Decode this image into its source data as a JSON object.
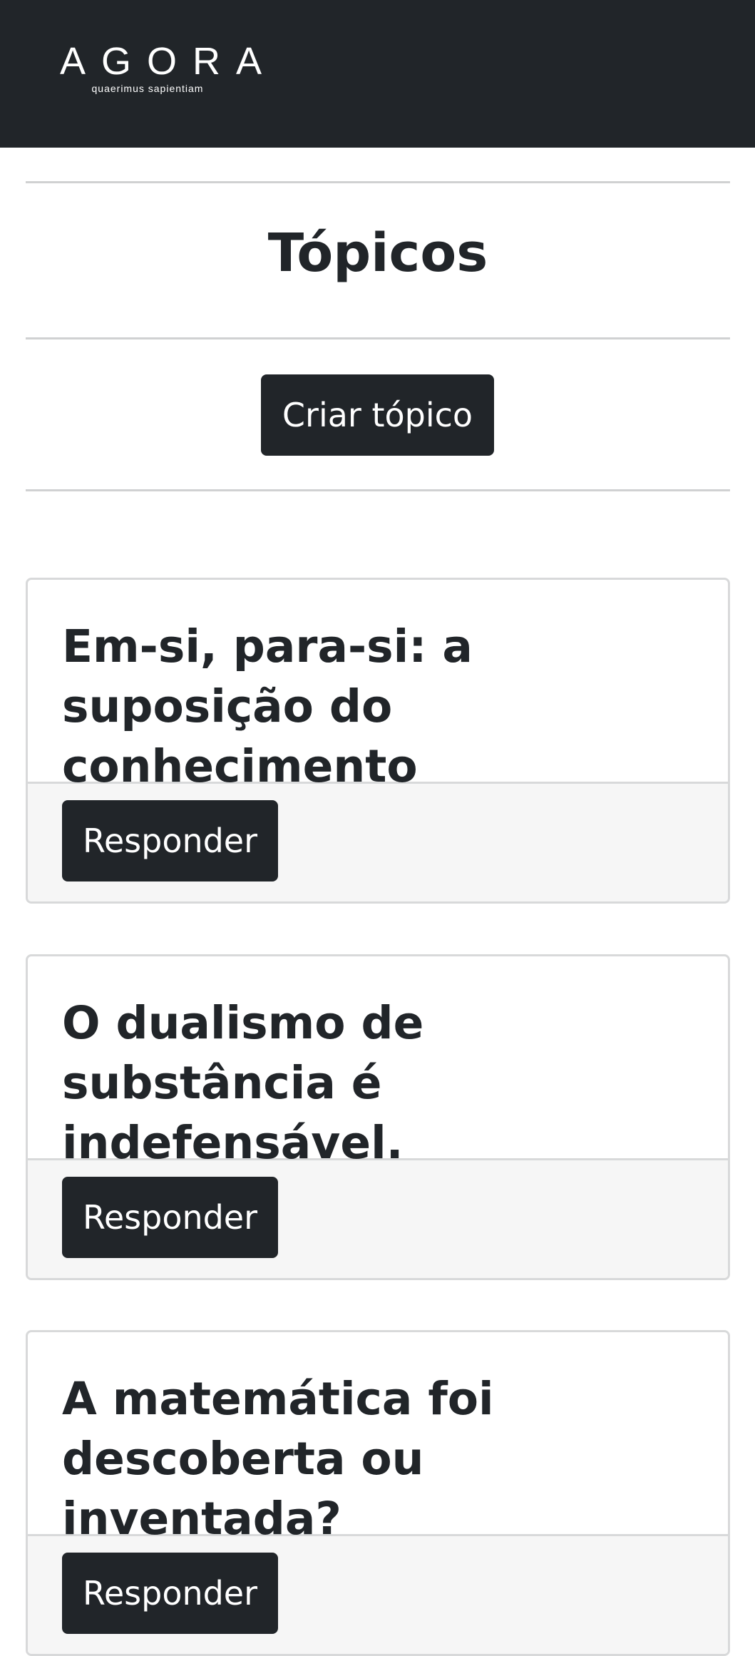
{
  "navbar": {
    "brand": "AGORA",
    "tagline": "quaerimus sapientiam"
  },
  "page": {
    "title": "Tópicos",
    "create_label": "Criar tópico"
  },
  "topics": [
    {
      "title": "Em-si, para-si: a suposição do conhecimento",
      "reply_label": "Responder"
    },
    {
      "title": "O dualismo de substância é indefensável.",
      "reply_label": "Responder"
    },
    {
      "title": "A matemática foi descoberta ou inventada?",
      "reply_label": "Responder"
    }
  ],
  "colors": {
    "navbar": "#212529",
    "button": "#212529",
    "footer": "#f6f6f6",
    "divider": "#d0d1d2"
  }
}
